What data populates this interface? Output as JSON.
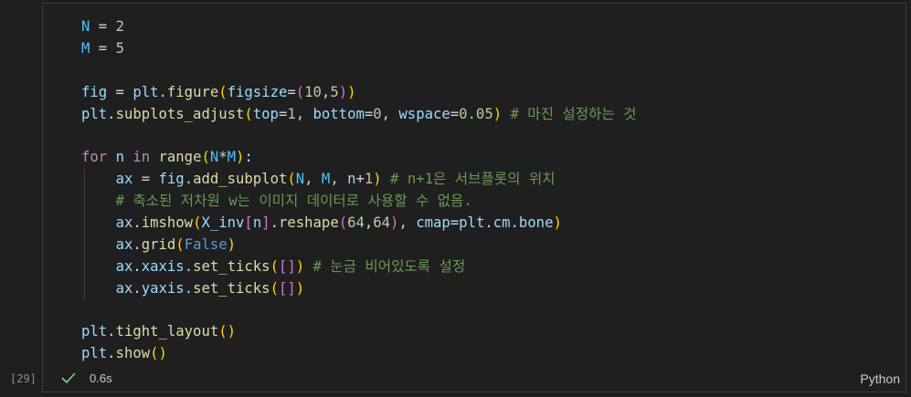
{
  "cell": {
    "execution_count": "[29]",
    "status_icon": "check-icon",
    "duration": "0.6s",
    "language": "Python",
    "lines": [
      [
        {
          "t": "N",
          "c": "const"
        },
        {
          "t": " = ",
          "c": "op"
        },
        {
          "t": "2",
          "c": "num"
        }
      ],
      [
        {
          "t": "M",
          "c": "const"
        },
        {
          "t": " = ",
          "c": "op"
        },
        {
          "t": "5",
          "c": "num"
        }
      ],
      [],
      [
        {
          "t": "fig",
          "c": "var"
        },
        {
          "t": " = ",
          "c": "op"
        },
        {
          "t": "plt",
          "c": "var"
        },
        {
          "t": ".",
          "c": "op"
        },
        {
          "t": "figure",
          "c": "fn"
        },
        {
          "t": "(",
          "c": "br1"
        },
        {
          "t": "figsize",
          "c": "var"
        },
        {
          "t": "=",
          "c": "op"
        },
        {
          "t": "(",
          "c": "br2"
        },
        {
          "t": "10",
          "c": "num"
        },
        {
          "t": ",",
          "c": "op"
        },
        {
          "t": "5",
          "c": "num"
        },
        {
          "t": ")",
          "c": "br2"
        },
        {
          "t": ")",
          "c": "br1"
        }
      ],
      [
        {
          "t": "plt",
          "c": "var"
        },
        {
          "t": ".",
          "c": "op"
        },
        {
          "t": "subplots_adjust",
          "c": "fn"
        },
        {
          "t": "(",
          "c": "br1"
        },
        {
          "t": "top",
          "c": "var"
        },
        {
          "t": "=",
          "c": "op"
        },
        {
          "t": "1",
          "c": "num"
        },
        {
          "t": ", ",
          "c": "op"
        },
        {
          "t": "bottom",
          "c": "var"
        },
        {
          "t": "=",
          "c": "op"
        },
        {
          "t": "0",
          "c": "num"
        },
        {
          "t": ", ",
          "c": "op"
        },
        {
          "t": "wspace",
          "c": "var"
        },
        {
          "t": "=",
          "c": "op"
        },
        {
          "t": "0.05",
          "c": "num"
        },
        {
          "t": ")",
          "c": "br1"
        },
        {
          "t": " # 마진 설정하는 것",
          "c": "com"
        }
      ],
      [],
      [
        {
          "t": "for",
          "c": "kw"
        },
        {
          "t": " ",
          "c": "op"
        },
        {
          "t": "n",
          "c": "var"
        },
        {
          "t": " ",
          "c": "op"
        },
        {
          "t": "in",
          "c": "kw"
        },
        {
          "t": " ",
          "c": "op"
        },
        {
          "t": "range",
          "c": "fn"
        },
        {
          "t": "(",
          "c": "br1"
        },
        {
          "t": "N",
          "c": "const"
        },
        {
          "t": "*",
          "c": "op"
        },
        {
          "t": "M",
          "c": "const"
        },
        {
          "t": ")",
          "c": "br1"
        },
        {
          "t": ":",
          "c": "op"
        }
      ],
      [
        {
          "t": "    ",
          "c": "op"
        },
        {
          "t": "ax",
          "c": "var"
        },
        {
          "t": " = ",
          "c": "op"
        },
        {
          "t": "fig",
          "c": "var"
        },
        {
          "t": ".",
          "c": "op"
        },
        {
          "t": "add_subplot",
          "c": "fn"
        },
        {
          "t": "(",
          "c": "br1"
        },
        {
          "t": "N",
          "c": "const"
        },
        {
          "t": ", ",
          "c": "op"
        },
        {
          "t": "M",
          "c": "const"
        },
        {
          "t": ", ",
          "c": "op"
        },
        {
          "t": "n",
          "c": "var"
        },
        {
          "t": "+",
          "c": "op"
        },
        {
          "t": "1",
          "c": "num"
        },
        {
          "t": ")",
          "c": "br1"
        },
        {
          "t": " # n+1은 서브플롯의 위치",
          "c": "com"
        }
      ],
      [
        {
          "t": "    ",
          "c": "op"
        },
        {
          "t": "# 축소된 저차원 w는 이미지 데이터로 사용할 수 없음.",
          "c": "com"
        }
      ],
      [
        {
          "t": "    ",
          "c": "op"
        },
        {
          "t": "ax",
          "c": "var"
        },
        {
          "t": ".",
          "c": "op"
        },
        {
          "t": "imshow",
          "c": "fn"
        },
        {
          "t": "(",
          "c": "br1"
        },
        {
          "t": "X_inv",
          "c": "var"
        },
        {
          "t": "[",
          "c": "br2"
        },
        {
          "t": "n",
          "c": "var"
        },
        {
          "t": "]",
          "c": "br2"
        },
        {
          "t": ".",
          "c": "op"
        },
        {
          "t": "reshape",
          "c": "fn"
        },
        {
          "t": "(",
          "c": "br2"
        },
        {
          "t": "64",
          "c": "num"
        },
        {
          "t": ",",
          "c": "op"
        },
        {
          "t": "64",
          "c": "num"
        },
        {
          "t": ")",
          "c": "br2"
        },
        {
          "t": ", ",
          "c": "op"
        },
        {
          "t": "cmap",
          "c": "var"
        },
        {
          "t": "=",
          "c": "op"
        },
        {
          "t": "plt",
          "c": "var"
        },
        {
          "t": ".",
          "c": "op"
        },
        {
          "t": "cm",
          "c": "var"
        },
        {
          "t": ".",
          "c": "op"
        },
        {
          "t": "bone",
          "c": "var"
        },
        {
          "t": ")",
          "c": "br1"
        }
      ],
      [
        {
          "t": "    ",
          "c": "op"
        },
        {
          "t": "ax",
          "c": "var"
        },
        {
          "t": ".",
          "c": "op"
        },
        {
          "t": "grid",
          "c": "fn"
        },
        {
          "t": "(",
          "c": "br1"
        },
        {
          "t": "False",
          "c": "bool"
        },
        {
          "t": ")",
          "c": "br1"
        }
      ],
      [
        {
          "t": "    ",
          "c": "op"
        },
        {
          "t": "ax",
          "c": "var"
        },
        {
          "t": ".",
          "c": "op"
        },
        {
          "t": "xaxis",
          "c": "var"
        },
        {
          "t": ".",
          "c": "op"
        },
        {
          "t": "set_ticks",
          "c": "fn"
        },
        {
          "t": "(",
          "c": "br1"
        },
        {
          "t": "[",
          "c": "br2"
        },
        {
          "t": "]",
          "c": "br2"
        },
        {
          "t": ")",
          "c": "br1"
        },
        {
          "t": " # 눈금 비어있도록 설정",
          "c": "com"
        }
      ],
      [
        {
          "t": "    ",
          "c": "op"
        },
        {
          "t": "ax",
          "c": "var"
        },
        {
          "t": ".",
          "c": "op"
        },
        {
          "t": "yaxis",
          "c": "var"
        },
        {
          "t": ".",
          "c": "op"
        },
        {
          "t": "set_ticks",
          "c": "fn"
        },
        {
          "t": "(",
          "c": "br1"
        },
        {
          "t": "[",
          "c": "br2"
        },
        {
          "t": "]",
          "c": "br2"
        },
        {
          "t": ")",
          "c": "br1"
        }
      ],
      [],
      [
        {
          "t": "plt",
          "c": "var"
        },
        {
          "t": ".",
          "c": "op"
        },
        {
          "t": "tight_layout",
          "c": "fn"
        },
        {
          "t": "(",
          "c": "br1"
        },
        {
          "t": ")",
          "c": "br1"
        }
      ],
      [
        {
          "t": "plt",
          "c": "var"
        },
        {
          "t": ".",
          "c": "op"
        },
        {
          "t": "show",
          "c": "fn"
        },
        {
          "t": "(",
          "c": "br1"
        },
        {
          "t": ")",
          "c": "br1"
        }
      ]
    ]
  }
}
